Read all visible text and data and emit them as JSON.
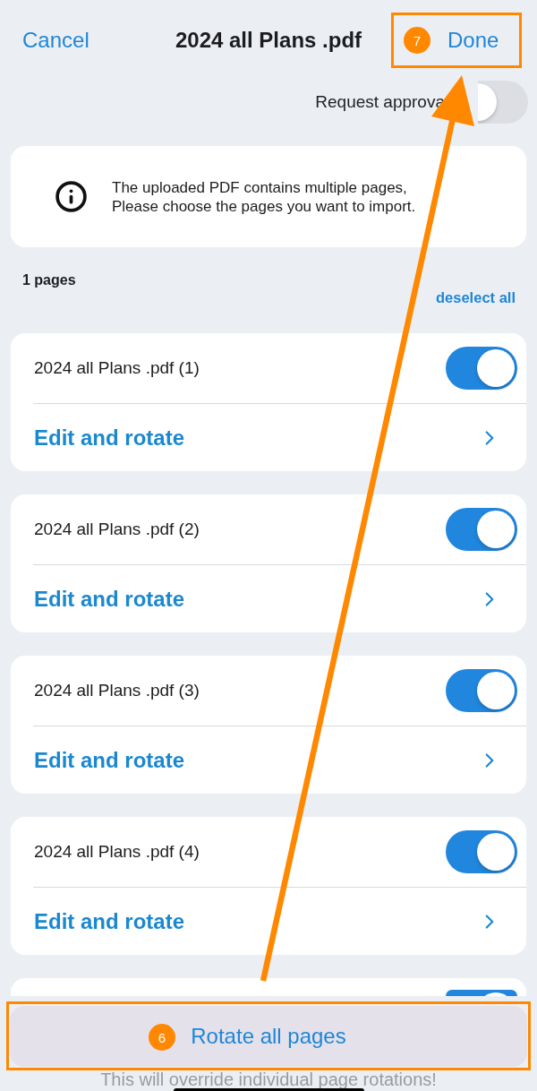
{
  "header": {
    "cancel": "Cancel",
    "title": "2024 all Plans .pdf",
    "done": "Done",
    "done_badge": "7"
  },
  "request_approval": {
    "label": "Request approva",
    "on": false
  },
  "info": {
    "message": "The uploaded PDF contains multiple pages,\nPlease choose the pages you want to import."
  },
  "pages_count": "1 pages",
  "deselect_all": "deselect all",
  "pages": [
    {
      "name": "2024 all Plans .pdf (1)",
      "selected": true,
      "action": "Edit and rotate"
    },
    {
      "name": "2024 all Plans .pdf (2)",
      "selected": true,
      "action": "Edit and rotate"
    },
    {
      "name": "2024 all Plans .pdf (3)",
      "selected": true,
      "action": "Edit and rotate"
    },
    {
      "name": "2024 all Plans .pdf (4)",
      "selected": true,
      "action": "Edit and rotate"
    },
    {
      "selected": true
    }
  ],
  "rotate_all": {
    "label": "Rotate all pages",
    "badge": "6",
    "note": "This will override individual page rotations!"
  }
}
